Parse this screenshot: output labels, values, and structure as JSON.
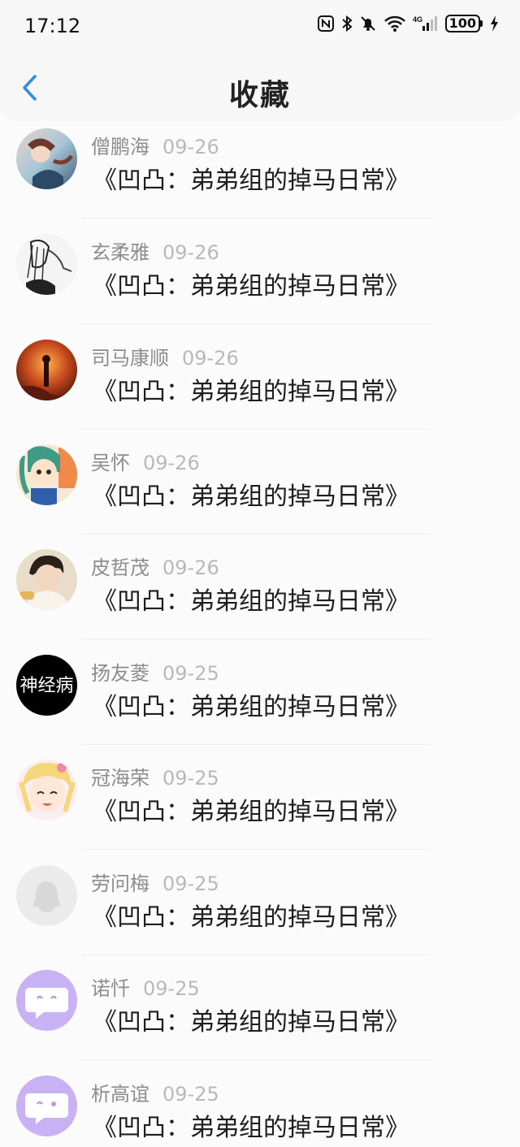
{
  "status_bar": {
    "time": "17:12",
    "battery": "100"
  },
  "header": {
    "title": "收藏"
  },
  "items": [
    {
      "name": "僧鹏海",
      "date": "09-26",
      "title": "《凹凸：弟弟组的掉马日常》",
      "avatar": "av1"
    },
    {
      "name": "玄柔雅",
      "date": "09-26",
      "title": "《凹凸：弟弟组的掉马日常》",
      "avatar": "av2"
    },
    {
      "name": "司马康顺",
      "date": "09-26",
      "title": "《凹凸：弟弟组的掉马日常》",
      "avatar": "av3"
    },
    {
      "name": "吴怀",
      "date": "09-26",
      "title": "《凹凸：弟弟组的掉马日常》",
      "avatar": "av4"
    },
    {
      "name": "皮哲茂",
      "date": "09-26",
      "title": "《凹凸：弟弟组的掉马日常》",
      "avatar": "av5"
    },
    {
      "name": "扬友菱",
      "date": "09-25",
      "title": "《凹凸：弟弟组的掉马日常》",
      "avatar": "av6",
      "avatar_text": "神经病"
    },
    {
      "name": "冠海荣",
      "date": "09-25",
      "title": "《凹凸：弟弟组的掉马日常》",
      "avatar": "av7"
    },
    {
      "name": "劳问梅",
      "date": "09-25",
      "title": "《凹凸：弟弟组的掉马日常》",
      "avatar": "av8"
    },
    {
      "name": "诺忏",
      "date": "09-25",
      "title": "《凹凸：弟弟组的掉马日常》",
      "avatar": "av9"
    },
    {
      "name": "析高谊",
      "date": "09-25",
      "title": "《凹凸：弟弟组的掉马日常》",
      "avatar": "av10"
    }
  ]
}
